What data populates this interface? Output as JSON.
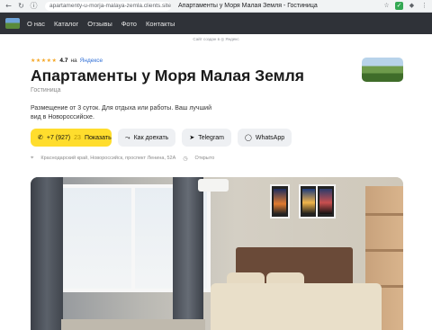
{
  "browser": {
    "url": "apartamenty-u-morja-malaya-zemla.clients.site",
    "tab_title": "Апартаменты у Моря Малая Земля - Гостиница"
  },
  "nav": {
    "items": [
      {
        "label": "О нас"
      },
      {
        "label": "Каталог"
      },
      {
        "label": "Отзывы"
      },
      {
        "label": "Фото"
      },
      {
        "label": "Контакты"
      }
    ]
  },
  "created_by": "Сайт создан в ◎ Яндекс",
  "rating": {
    "stars": "★★★★★",
    "value": "4.7",
    "on": "на",
    "source": "Яндексе"
  },
  "title": "Апартаменты у Моря Малая Земля",
  "category": "Гостиница",
  "description": "Размещение от 3 суток. Для отдыха или работы. Ваш лучший вид в Новороссийске.",
  "buttons": {
    "phone": {
      "number": "+7 (927)",
      "hidden": "23",
      "label": "Показать",
      "icon": "phone-icon"
    },
    "route": {
      "label": "Как доехать",
      "icon": "route-icon"
    },
    "telegram": {
      "label": "Telegram",
      "icon": "telegram-icon"
    },
    "whatsapp": {
      "label": "WhatsApp",
      "icon": "whatsapp-icon"
    }
  },
  "info": {
    "address": "Краснодарский край, Новороссийск, проспект Ленина, 52А",
    "status": "Открыто"
  },
  "colors": {
    "nav_bg": "#2f3238",
    "accent_yellow": "#ffdd2d",
    "button_bg": "#eef0f3"
  }
}
